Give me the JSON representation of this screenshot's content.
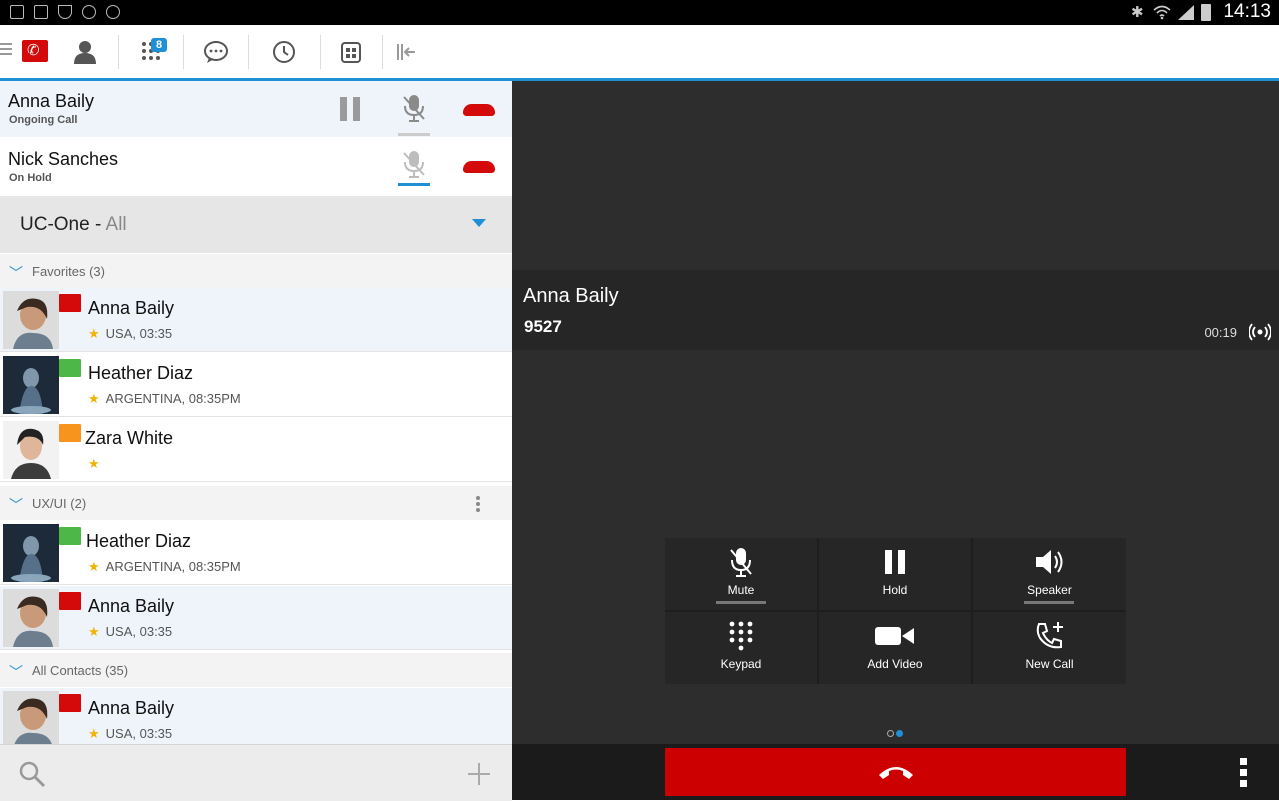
{
  "status_bar": {
    "time": "14:13"
  },
  "tabs": [
    {
      "name": "contacts",
      "active": true
    },
    {
      "name": "dialpad",
      "badge": "8"
    },
    {
      "name": "chat"
    },
    {
      "name": "history"
    },
    {
      "name": "directory"
    },
    {
      "name": "collapse"
    }
  ],
  "calls": [
    {
      "name": "Anna Baily",
      "status": "Ongoing Call"
    },
    {
      "name": "Nick Sanches",
      "status": "On Hold"
    }
  ],
  "source": {
    "label": "UC-One - ",
    "filter": "All"
  },
  "groups": [
    {
      "label": "Favorites (3)"
    },
    {
      "label": "UX/UI (2)"
    },
    {
      "label": "All Contacts (35)"
    }
  ],
  "favorites": [
    {
      "name": "Anna Baily",
      "sub": "USA, 03:35",
      "flag_color": "#d40a0a"
    },
    {
      "name": "Heather Diaz",
      "sub": "ARGENTINA, 08:35PM",
      "flag_color": "#4db848"
    },
    {
      "name": "Zara White",
      "sub": "",
      "flag_color": "#f7941d"
    }
  ],
  "uxui": [
    {
      "name": "Heather Diaz",
      "sub": "ARGENTINA, 08:35PM",
      "flag_color": "#4db848"
    },
    {
      "name": "Anna Baily",
      "sub": "USA, 03:35",
      "flag_color": "#d40a0a"
    }
  ],
  "all_contacts": [
    {
      "name": "Anna Baily",
      "sub": "USA, 03:35",
      "flag_color": "#d40a0a"
    }
  ],
  "active_call": {
    "name": "Anna Baily",
    "number": "9527",
    "duration": "00:19"
  },
  "controls": {
    "mute": "Mute",
    "hold": "Hold",
    "speaker": "Speaker",
    "keypad": "Keypad",
    "add_video": "Add Video",
    "new_call": "New Call"
  },
  "colors": {
    "accent": "#1f8fd6",
    "end_call": "#cc0000",
    "star": "#f3b200"
  }
}
